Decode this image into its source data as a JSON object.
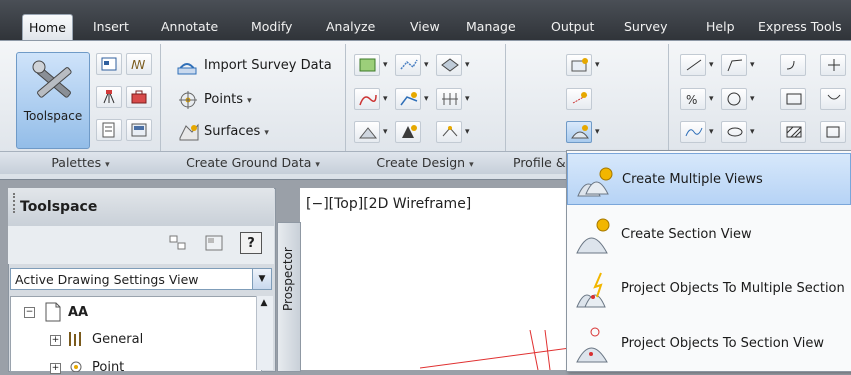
{
  "tabs": [
    "Home",
    "Insert",
    "Annotate",
    "Modify",
    "Analyze",
    "View",
    "Manage",
    "Output",
    "Survey",
    "Help",
    "Express Tools"
  ],
  "ribbon": {
    "toolspace_label": "Toolspace",
    "import_survey_label": "Import Survey Data",
    "points_label": "Points",
    "surfaces_label": "Surfaces",
    "panels": [
      "Palettes",
      "Create Ground Data",
      "Create Design",
      "Profile &"
    ],
    "caret": "▾"
  },
  "palette": {
    "title": "Toolspace",
    "view_select_value": "Active Drawing Settings View",
    "help_label": "?",
    "side_tab": "Prospector",
    "tree": [
      {
        "label": "AA",
        "level": 0
      },
      {
        "label": "General",
        "level": 1
      },
      {
        "label": "Point",
        "level": 1
      }
    ]
  },
  "canvas": {
    "viewport_label": "[−][Top][2D Wireframe]"
  },
  "menu": {
    "items": [
      "Create Multiple Views",
      "Create Section View",
      "Project Objects To Multiple Section",
      "Project Objects To Section View"
    ]
  },
  "colors": {
    "tabbar": "#3a3e44",
    "ribbon": "#e6eaef",
    "highlight": "#c6ddf8",
    "canvas": "#ffffff",
    "accent": "#3f74c2"
  }
}
